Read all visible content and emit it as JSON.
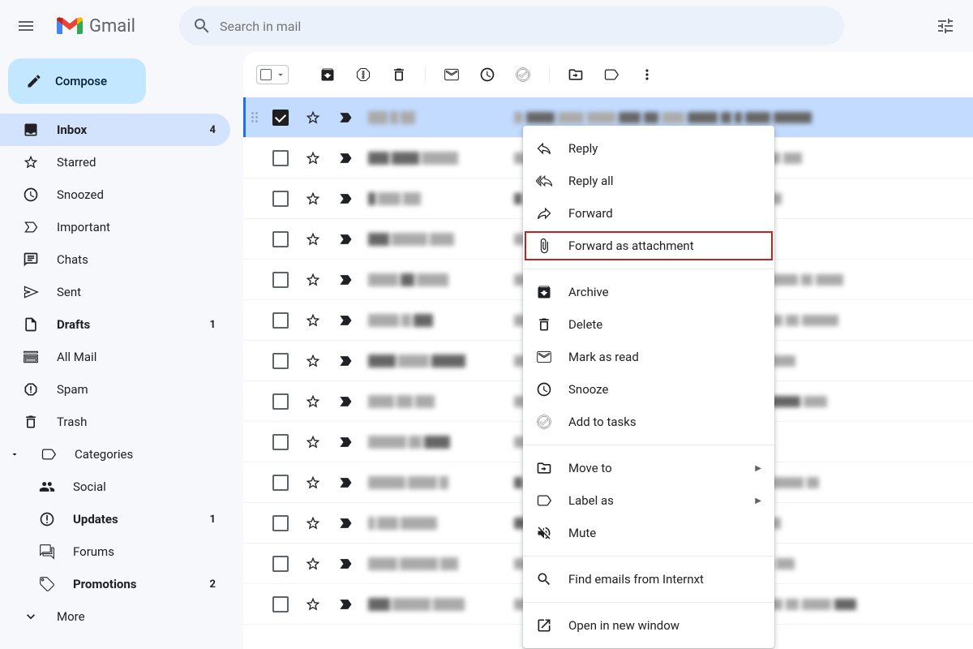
{
  "header": {
    "app_name": "Gmail",
    "search_placeholder": "Search in mail"
  },
  "sidebar": {
    "compose_label": "Compose",
    "items": [
      {
        "label": "Inbox",
        "count": "4",
        "active": true,
        "bold": true,
        "icon": "inbox"
      },
      {
        "label": "Starred",
        "icon": "star"
      },
      {
        "label": "Snoozed",
        "icon": "clock"
      },
      {
        "label": "Important",
        "icon": "important"
      },
      {
        "label": "Chats",
        "icon": "chat"
      },
      {
        "label": "Sent",
        "icon": "send"
      },
      {
        "label": "Drafts",
        "count": "1",
        "bold": true,
        "icon": "file"
      },
      {
        "label": "All Mail",
        "icon": "stacked"
      },
      {
        "label": "Spam",
        "icon": "spam"
      },
      {
        "label": "Trash",
        "icon": "trash"
      },
      {
        "label": "Categories",
        "icon": "label",
        "expandable": true
      }
    ],
    "categories": [
      {
        "label": "Social",
        "icon": "people"
      },
      {
        "label": "Updates",
        "count": "1",
        "bold": true,
        "icon": "info"
      },
      {
        "label": "Forums",
        "icon": "forum"
      },
      {
        "label": "Promotions",
        "count": "2",
        "bold": true,
        "icon": "tag"
      }
    ],
    "more_label": "More"
  },
  "emails": [
    {
      "selected": true,
      "starred": false,
      "important": true
    },
    {
      "selected": false,
      "starred": false,
      "important": true
    },
    {
      "selected": false,
      "starred": false,
      "important": true
    },
    {
      "selected": false,
      "starred": false,
      "important": true
    },
    {
      "selected": false,
      "starred": false,
      "important": true
    },
    {
      "selected": false,
      "starred": false,
      "important": true
    },
    {
      "selected": false,
      "starred": false,
      "important": true
    },
    {
      "selected": false,
      "starred": false,
      "important": true
    },
    {
      "selected": false,
      "starred": false,
      "important": true
    },
    {
      "selected": false,
      "starred": false,
      "important": true
    },
    {
      "selected": false,
      "starred": false,
      "important": true
    },
    {
      "selected": false,
      "starred": false,
      "important": true
    },
    {
      "selected": false,
      "starred": false,
      "important": true
    }
  ],
  "context_menu": {
    "items": [
      {
        "label": "Reply",
        "icon": "reply"
      },
      {
        "label": "Reply all",
        "icon": "reply-all"
      },
      {
        "label": "Forward",
        "icon": "forward"
      },
      {
        "label": "Forward as attachment",
        "icon": "attachment",
        "highlighted": true
      },
      {
        "sep": true
      },
      {
        "label": "Archive",
        "icon": "archive"
      },
      {
        "label": "Delete",
        "icon": "trash"
      },
      {
        "label": "Mark as read",
        "icon": "mark-read"
      },
      {
        "label": "Snooze",
        "icon": "clock"
      },
      {
        "label": "Add to tasks",
        "icon": "task"
      },
      {
        "sep": true
      },
      {
        "label": "Move to",
        "icon": "move",
        "submenu": true
      },
      {
        "label": "Label as",
        "icon": "label",
        "submenu": true
      },
      {
        "label": "Mute",
        "icon": "mute"
      },
      {
        "sep": true
      },
      {
        "label": "Find emails from Internxt",
        "icon": "search"
      },
      {
        "sep": true
      },
      {
        "label": "Open in new window",
        "icon": "open-new"
      }
    ]
  }
}
